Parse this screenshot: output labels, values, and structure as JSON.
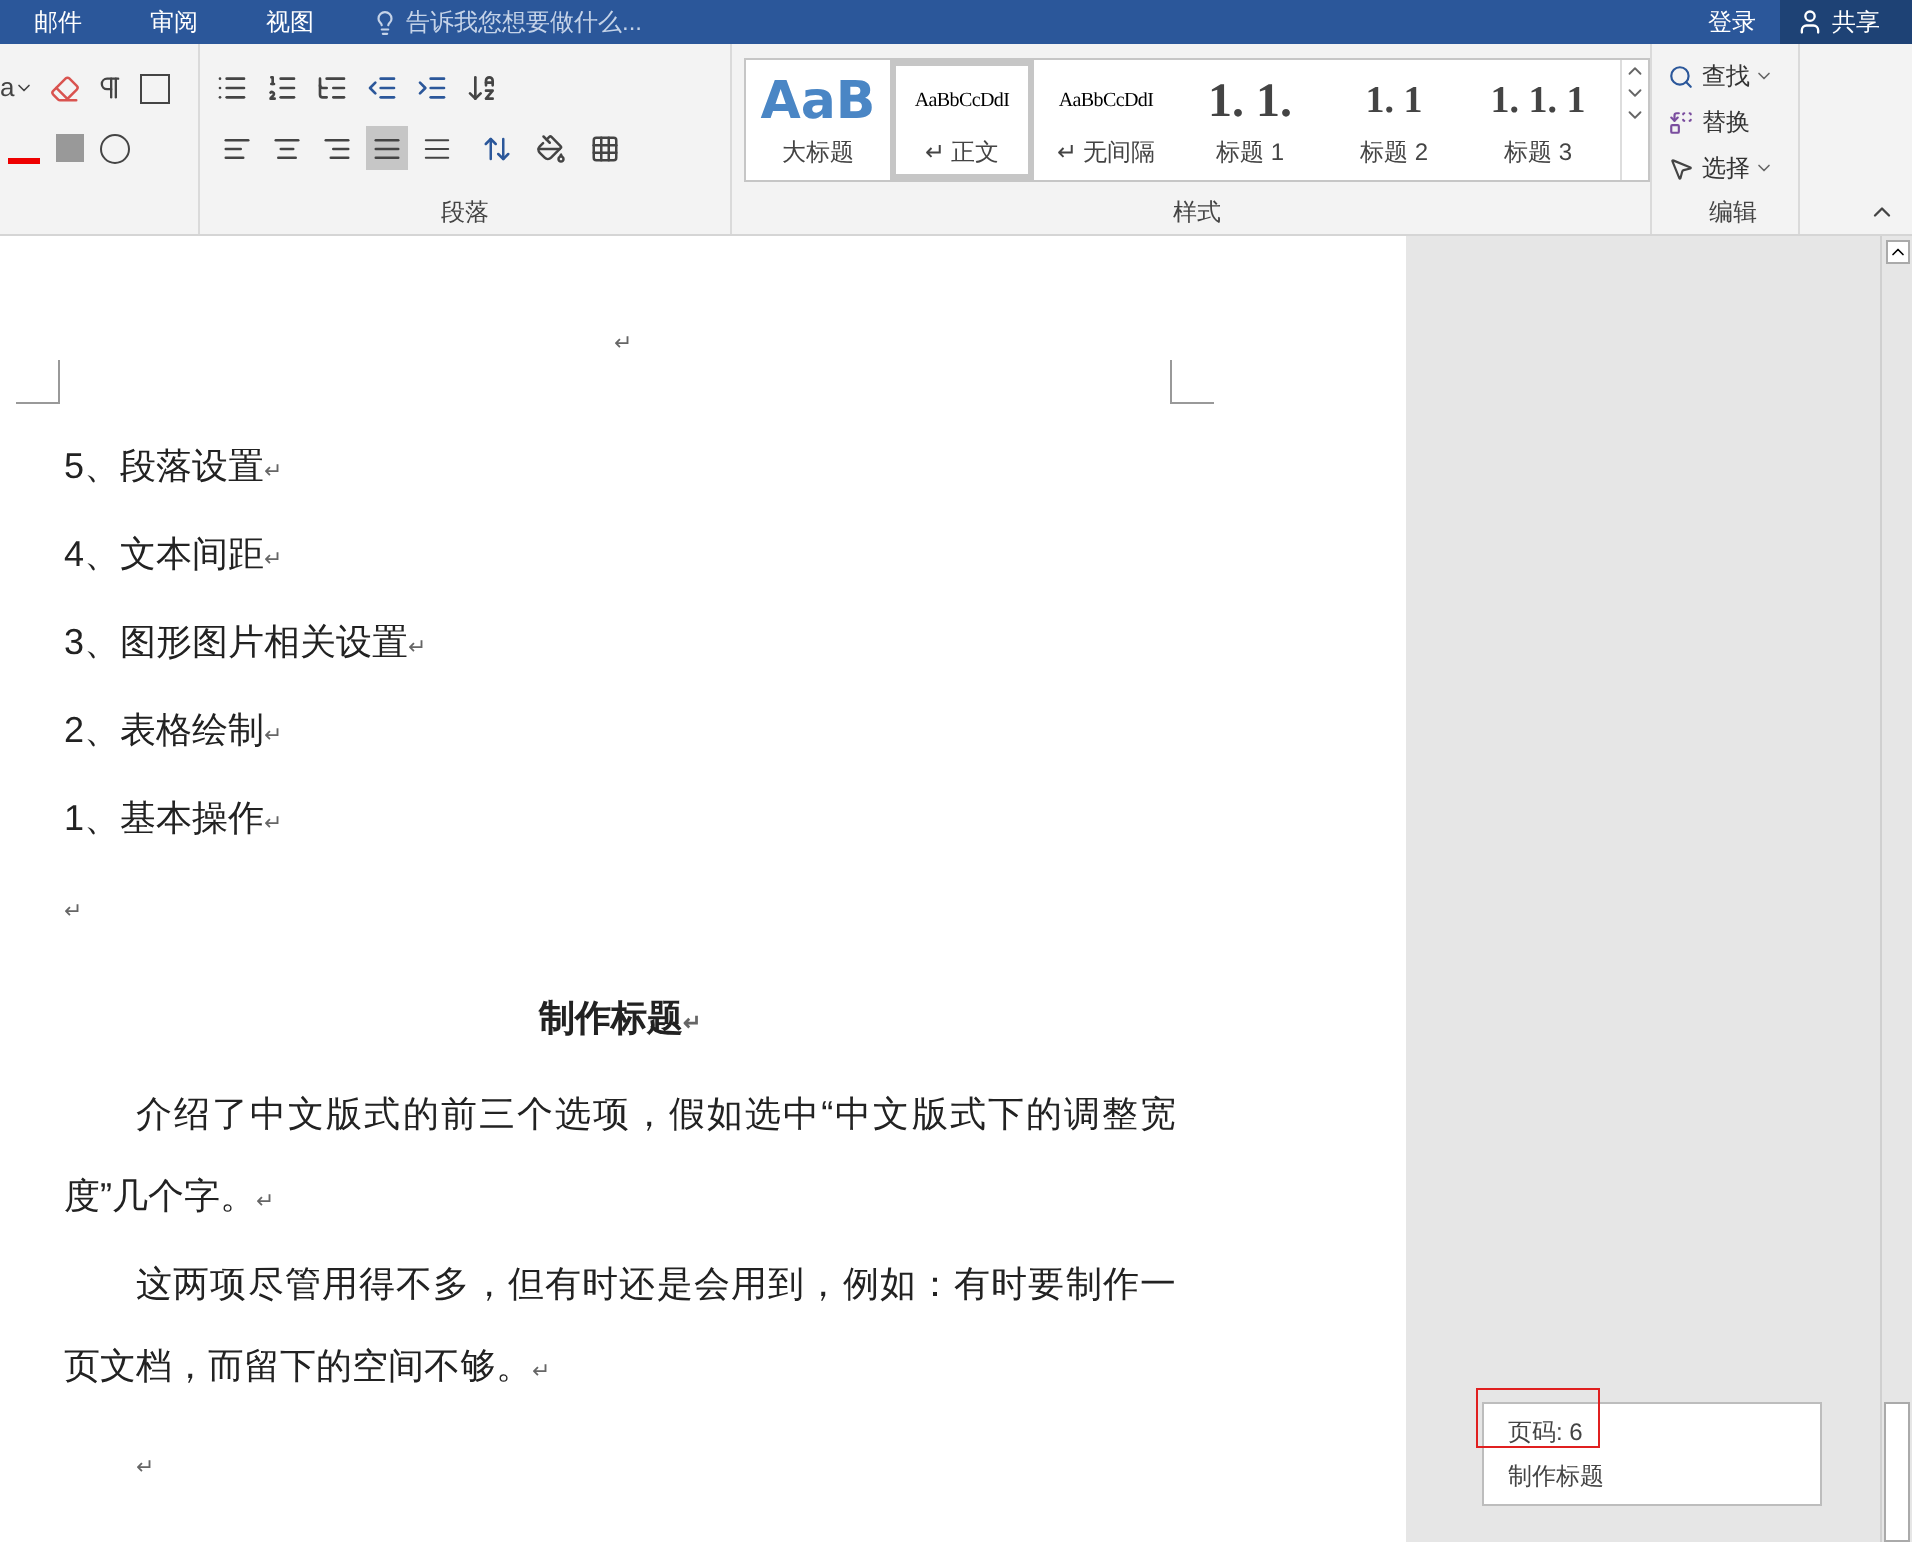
{
  "title_bar": {
    "tabs": [
      {
        "label": "邮件",
        "selected": false
      },
      {
        "label": "审阅",
        "selected": false
      },
      {
        "label": "视图",
        "selected": false
      }
    ],
    "tell_me": {
      "placeholder": "告诉我您想要做什么..."
    },
    "sign_in": "登录",
    "share": "共享"
  },
  "ribbon": {
    "font_partial": "a",
    "align_buttons": [
      {
        "kind": "left",
        "selected": false
      },
      {
        "kind": "center",
        "selected": false
      },
      {
        "kind": "right",
        "selected": false
      },
      {
        "kind": "justify",
        "selected": true
      },
      {
        "kind": "distributed",
        "selected": false
      }
    ],
    "paragraph_label": "段落",
    "styles": [
      {
        "kind": "title",
        "preview": "AaB",
        "name": "大标题",
        "selected": false
      },
      {
        "kind": "body",
        "preview": "AaBbCcDdI",
        "name": "正文",
        "mark": "↵",
        "selected": true
      },
      {
        "kind": "body",
        "preview": "AaBbCcDdI",
        "name": "无间隔",
        "mark": "↵",
        "selected": false
      },
      {
        "kind": "heading1",
        "preview": "1. 1.",
        "name": "标题 1",
        "selected": false
      },
      {
        "kind": "heading2",
        "preview": "1. 1",
        "name": "标题 2",
        "selected": false
      },
      {
        "kind": "heading3",
        "preview": "1. 1. 1",
        "name": "标题 3",
        "selected": false
      }
    ],
    "styles_label": "样式",
    "edit_buttons": [
      {
        "kind": "find",
        "label": "查找",
        "dropdown": true
      },
      {
        "kind": "replace",
        "label": "替换",
        "dropdown": false
      },
      {
        "kind": "select",
        "label": "选择",
        "dropdown": true
      }
    ],
    "edit_label": "编辑"
  },
  "document": {
    "header_mark": "↵",
    "paragraphs": [
      {
        "kind": "list",
        "text": "5、段落设置",
        "mark": "↵"
      },
      {
        "kind": "list",
        "text": "4、文本间距",
        "mark": "↵"
      },
      {
        "kind": "list",
        "text": "3、图形图片相关设置",
        "mark": "↵"
      },
      {
        "kind": "list",
        "text": "2、表格绘制",
        "mark": "↵"
      },
      {
        "kind": "list",
        "text": "1、基本操作",
        "mark": "↵"
      },
      {
        "kind": "empty",
        "mark": "↵"
      },
      {
        "kind": "heading",
        "text": "制作标题",
        "mark": "↵"
      },
      {
        "kind": "body",
        "text": "介绍了中文版式的前三个选项，假如选中“中文版式下的调整宽度”几个字。",
        "mark": "↵"
      },
      {
        "kind": "body",
        "text": "这两项尽管用得不多，但有时还是会用到，例如：有时要制作一页文档，而留下的空间不够。",
        "mark": "↵"
      },
      {
        "kind": "indented_empty",
        "mark": "↵"
      }
    ]
  },
  "page_tooltip": {
    "page": "页码: 6",
    "heading": "制作标题"
  }
}
